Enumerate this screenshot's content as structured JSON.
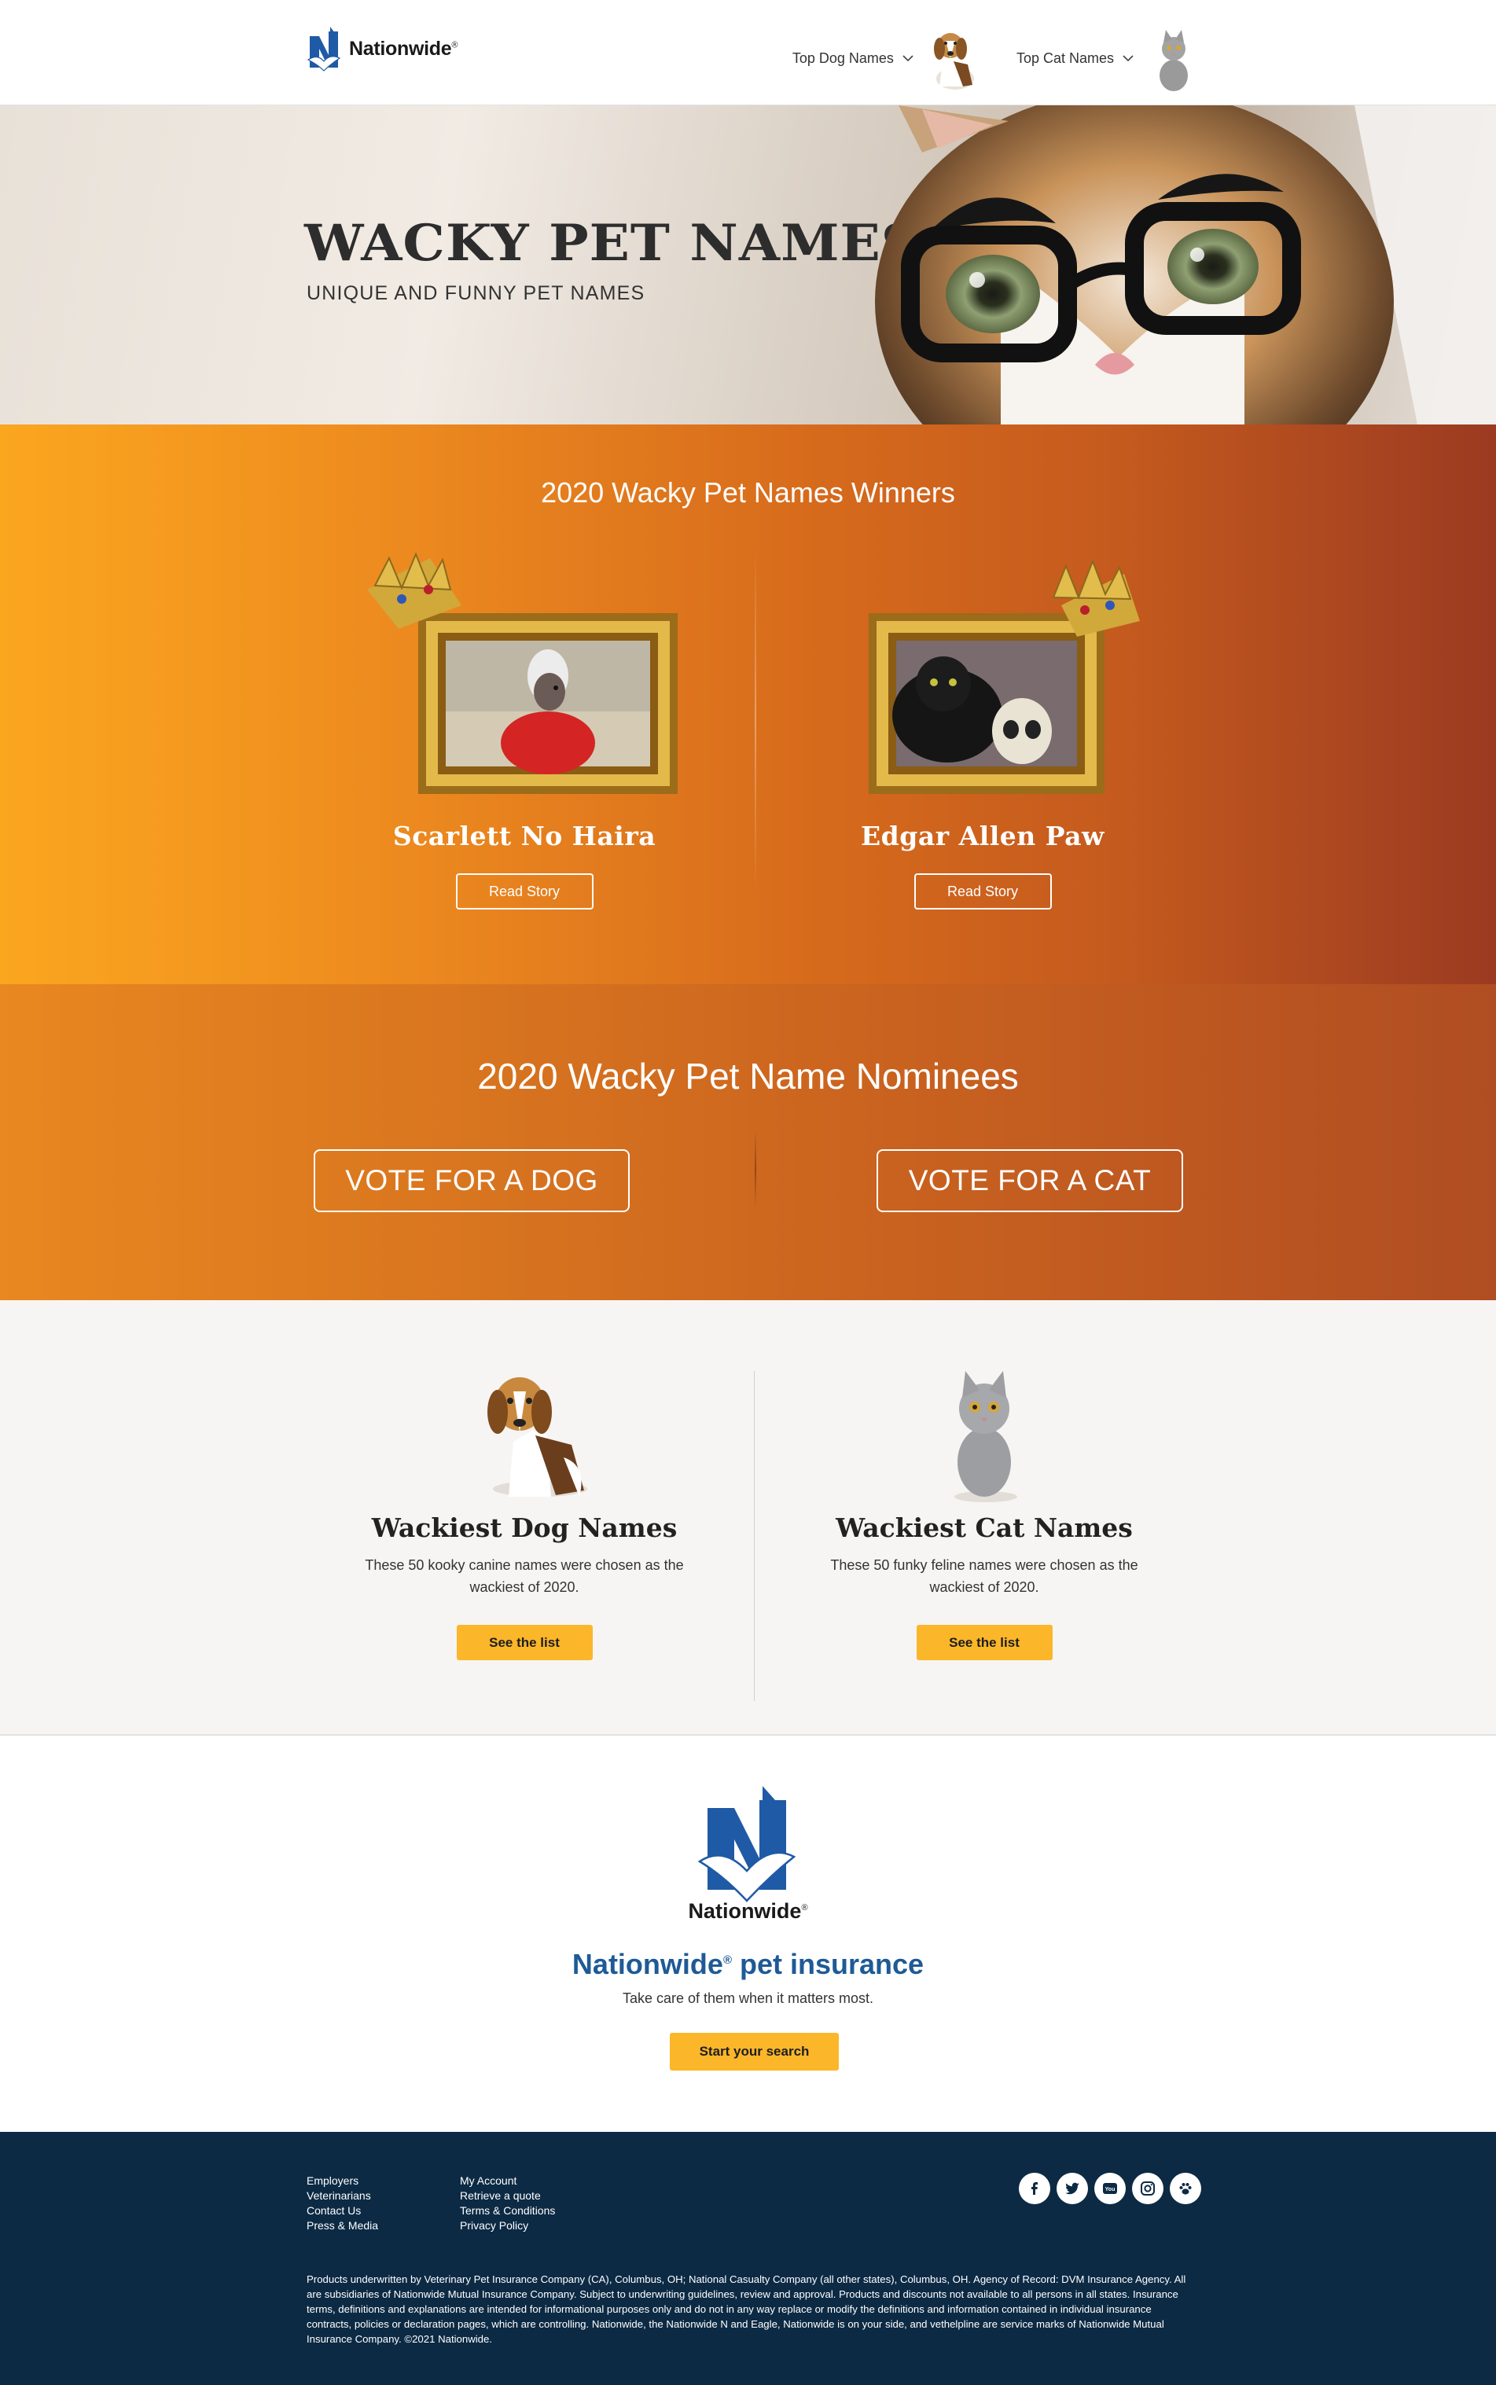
{
  "header": {
    "brand": "Nationwide",
    "nav": [
      {
        "label": "Top Dog Names",
        "icon": "chevron-down-icon",
        "pet": "beagle-image"
      },
      {
        "label": "Top Cat Names",
        "icon": "chevron-down-icon",
        "pet": "kitten-image"
      }
    ]
  },
  "hero": {
    "title": "WACKY PET NAMES",
    "subtitle": "UNIQUE AND FUNNY PET NAMES"
  },
  "winners": {
    "title": "2020 Wacky Pet Names Winners",
    "items": [
      {
        "name": "Scarlett No Haira",
        "button": "Read Story",
        "photo": "crested-dog-in-red-sweater"
      },
      {
        "name": "Edgar Allen Paw",
        "button": "Read Story",
        "photo": "black-cat-with-skull"
      }
    ]
  },
  "nominees": {
    "title": "2020 Wacky Pet Name Nominees",
    "dog_button": "VOTE FOR A DOG",
    "cat_button": "VOTE FOR A CAT"
  },
  "wackiest": [
    {
      "title": "Wackiest Dog Names",
      "desc": "These 50 kooky canine names were chosen as the wackiest of 2020.",
      "button": "See the list"
    },
    {
      "title": "Wackiest Cat Names",
      "desc": "These 50 funky feline names were chosen as the wackiest of 2020.",
      "button": "See the list"
    }
  ],
  "promo": {
    "brand": "Nationwide",
    "title": "Nationwide",
    "title_suffix": " pet insurance",
    "subtitle": "Take care of them when it matters most.",
    "button": "Start your search"
  },
  "footer": {
    "col_a": [
      "Employers",
      "Veterinarians",
      "Contact Us",
      "Press & Media"
    ],
    "col_b": [
      "My Account",
      "Retrieve a quote",
      "Terms & Conditions",
      "Privacy Policy"
    ],
    "social": [
      "facebook-icon",
      "twitter-icon",
      "youtube-icon",
      "instagram-icon",
      "paw-icon"
    ],
    "legal": "Products underwritten by Veterinary Pet Insurance Company (CA), Columbus, OH; National Casualty Company (all other states), Columbus, OH. Agency of Record: DVM Insurance Agency. All are subsidiaries of Nationwide Mutual Insurance Company. Subject to underwriting guidelines, review and approval. Products and discounts not available to all persons in all states. Insurance terms, definitions and explanations are intended for informational purposes only and do not in any way replace or modify the definitions and information contained in individual insurance contracts, policies or declaration pages, which are controlling. Nationwide, the Nationwide N and Eagle, Nationwide is on your side, and vethelpline are service marks of Nationwide Mutual Insurance Company. ©2021 Nationwide."
  },
  "colors": {
    "accent_yellow": "#fbb62a",
    "orange_start": "#fba61f",
    "rust_end": "#9b3a21",
    "footer_navy": "#0c2a44",
    "brand_blue": "#1f5a96"
  }
}
